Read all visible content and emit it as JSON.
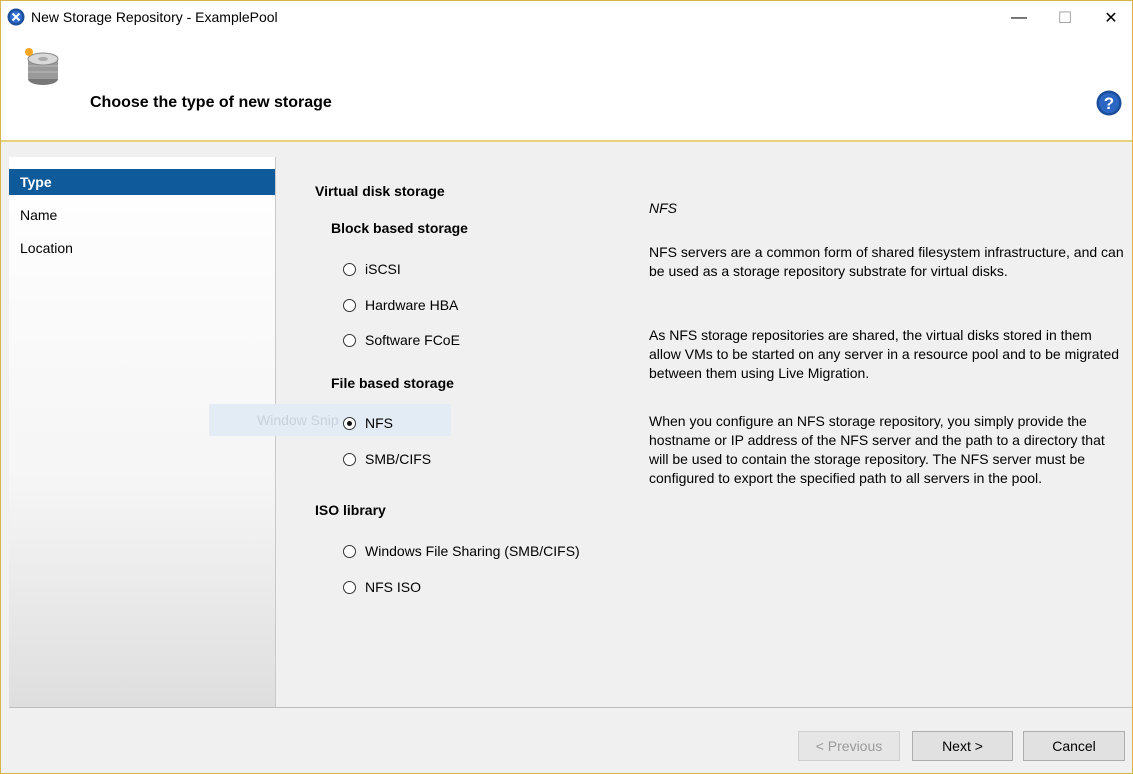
{
  "window": {
    "title": "New Storage Repository - ExamplePool",
    "minimize_glyph": "—",
    "maximize_glyph": "☐",
    "close_glyph": "✕"
  },
  "header": {
    "title": "Choose the type of new storage",
    "icon": "storage-disk-icon",
    "help_icon": "help-icon"
  },
  "sidebar": {
    "items": [
      {
        "label": "Type",
        "active": true
      },
      {
        "label": "Name",
        "active": false
      },
      {
        "label": "Location",
        "active": false
      }
    ]
  },
  "options": {
    "virtual_disk_label": "Virtual disk storage",
    "block_label": "Block based storage",
    "iscsi": "iSCSI",
    "hardware_hba": "Hardware HBA",
    "software_fcoe": "Software FCoE",
    "file_label": "File based storage",
    "nfs": "NFS",
    "smb_cifs": "SMB/CIFS",
    "iso_label": "ISO library",
    "windows_file_sharing": "Windows File Sharing (SMB/CIFS)",
    "nfs_iso": "NFS ISO",
    "selected": "NFS"
  },
  "ghost_overlay": "Window Snip",
  "description": {
    "title": "NFS",
    "p1": "NFS servers are a common form of shared filesystem infrastructure, and can be used as a storage repository substrate for virtual disks.",
    "p2": "As NFS storage repositories are shared, the virtual disks stored in them allow VMs to be started on any server in a resource pool and to be migrated between them using Live Migration.",
    "p3": "When you configure an NFS storage repository, you simply provide the hostname or IP address of the NFS server and the path to a directory that will be used to contain the storage repository. The NFS server must be configured to export the specified path to all servers in the pool."
  },
  "footer": {
    "previous": "< Previous",
    "next": "Next >",
    "cancel": "Cancel"
  },
  "colors": {
    "accent": "#0f5a9a",
    "window_border": "#d8b24a"
  }
}
